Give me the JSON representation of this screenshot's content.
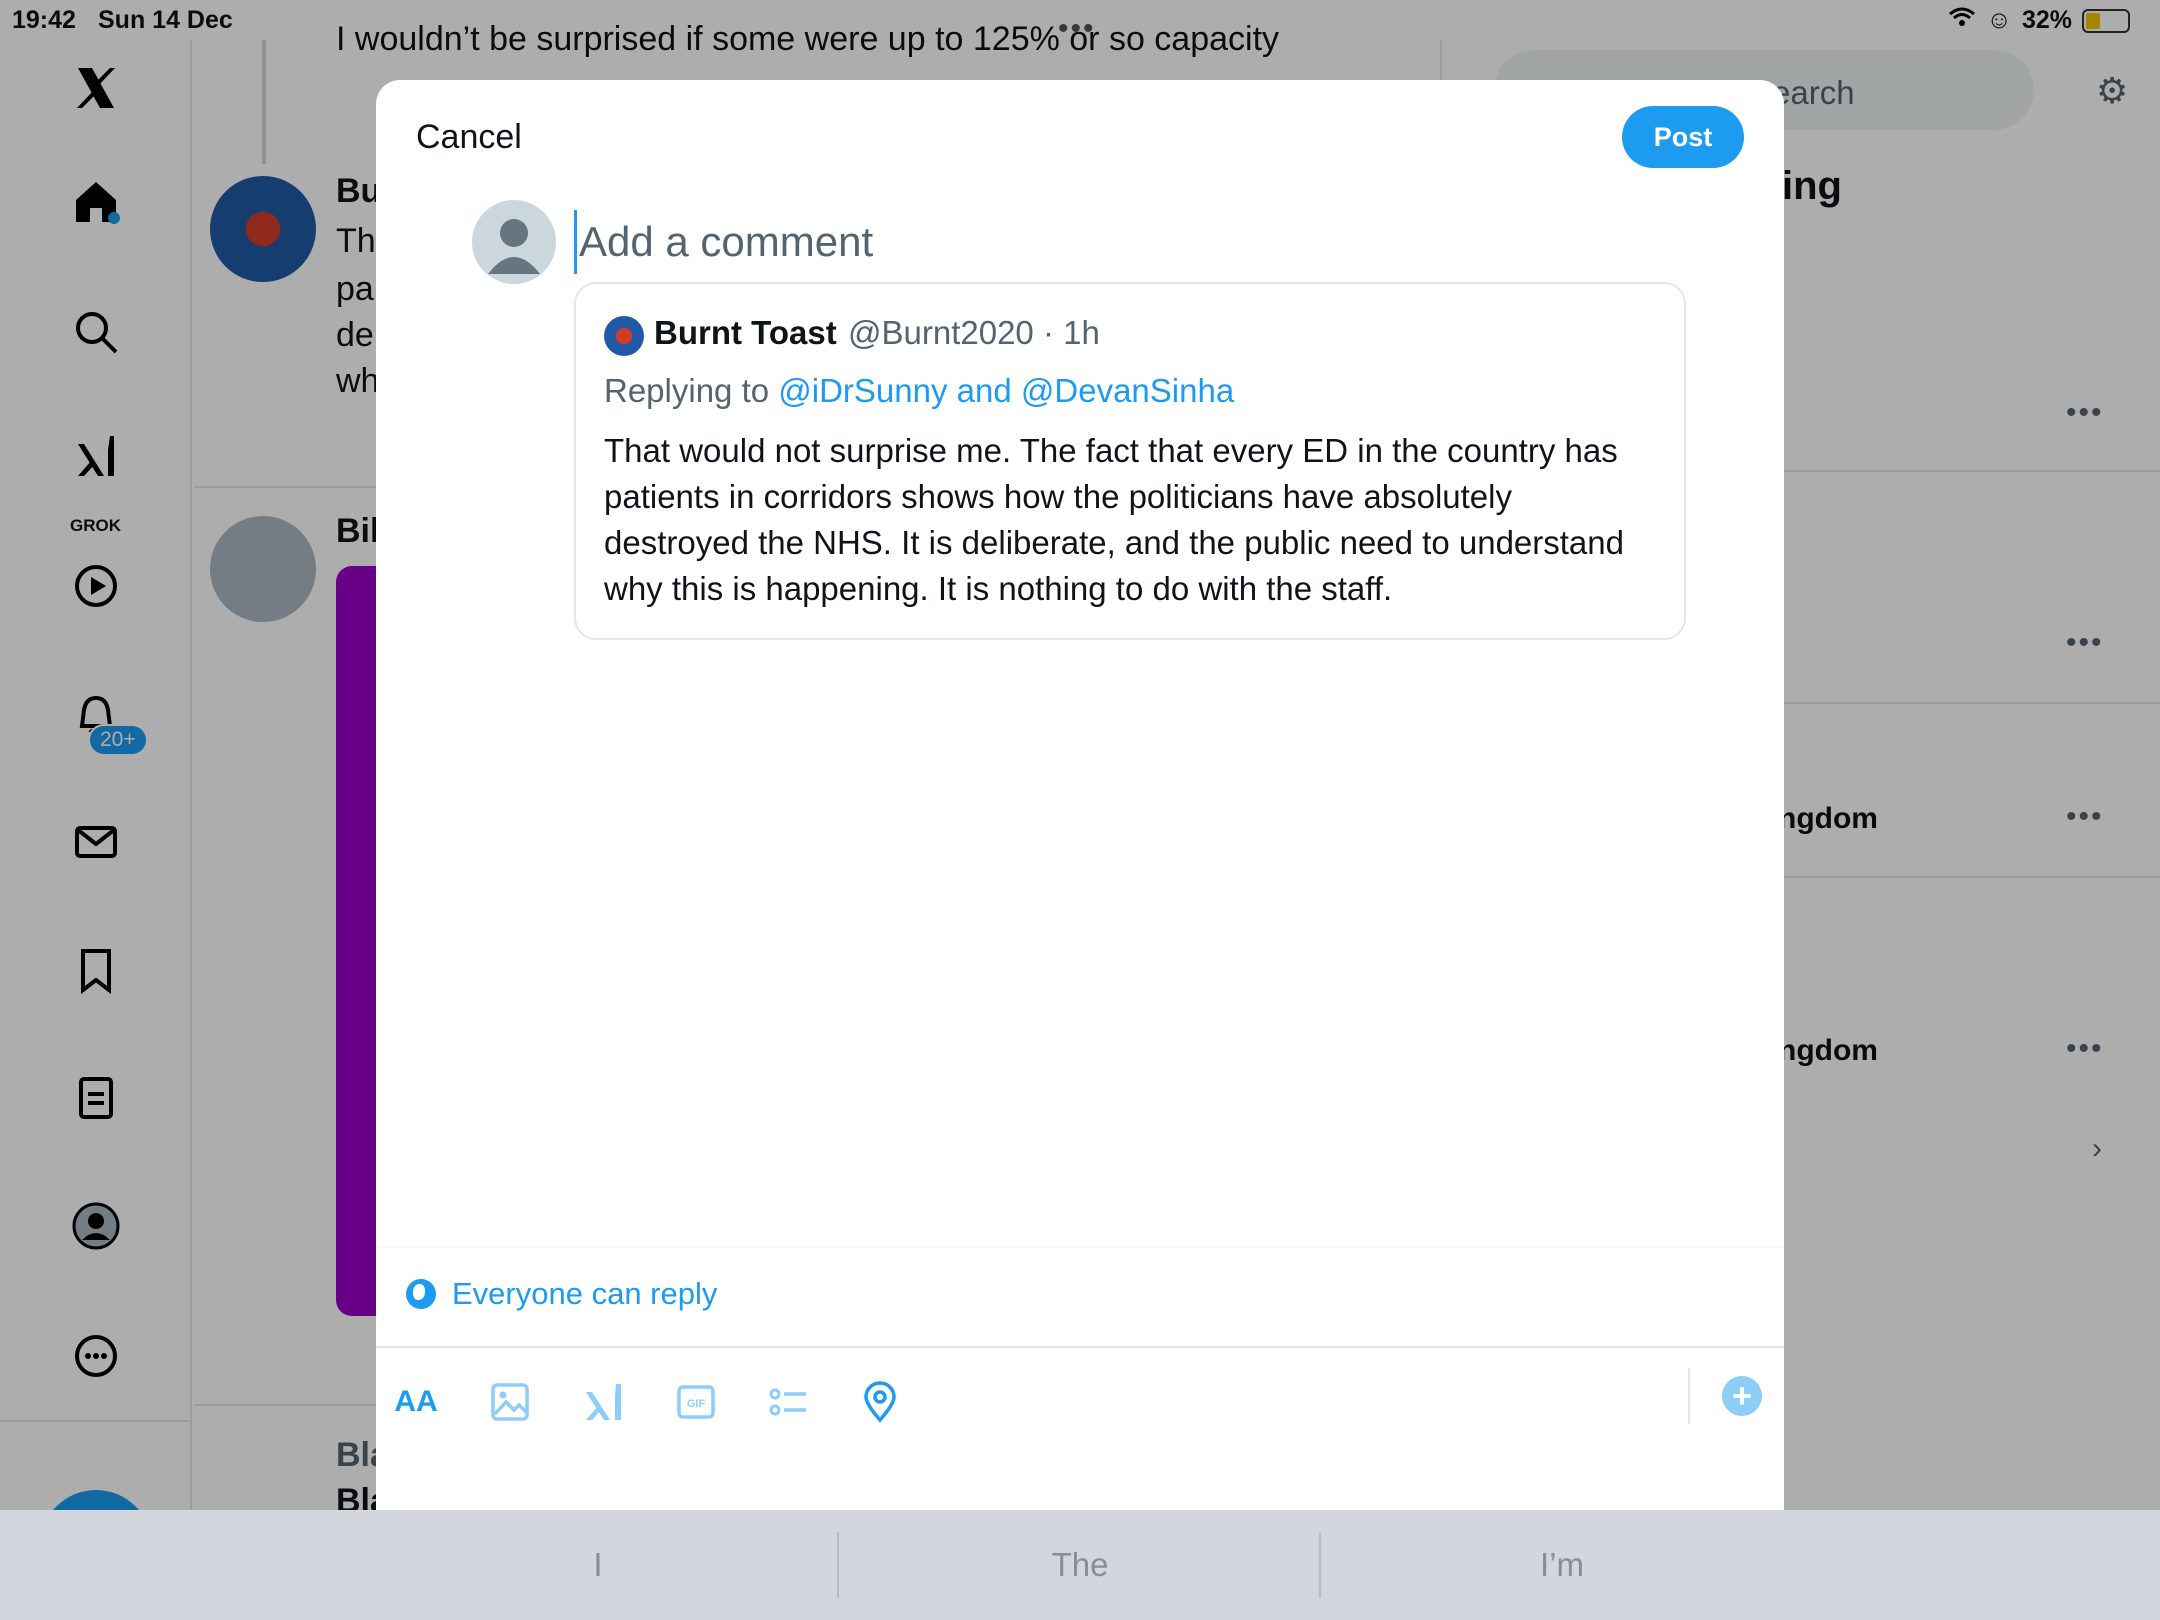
{
  "status_bar": {
    "time": "19:42",
    "date": "Sun 14 Dec",
    "battery": "32%"
  },
  "nav": {
    "grok_label": "GROK",
    "notifications_badge": "20+"
  },
  "background_timeline": {
    "top_reply_text": "I wouldn’t be surprised if some were up to 125% or so capacity",
    "post1_name_fragment": "Bu",
    "post1_lines": [
      "Th",
      "pa",
      "de",
      "wh"
    ],
    "post2_name_fragment": "Bil",
    "repost_fragment": "Bla",
    "post3_name_fragment": "Bla"
  },
  "background_right": {
    "search_placeholder": "Search",
    "section_fragment": "ing",
    "trend1_fragment": "ngdom",
    "trend2_fragment": "ngdom"
  },
  "compose": {
    "cancel_label": "Cancel",
    "post_label": "Post",
    "comment_placeholder": "Add a comment",
    "reply_setting": "Everyone can reply",
    "toolbar": {
      "text_format_label": "AA"
    }
  },
  "quoted_post": {
    "name": "Burnt Toast",
    "handle_time": "@Burnt2020 · 1h",
    "replying_prefix": "Replying to ",
    "replying_to": "@iDrSunny and @DevanSinha",
    "body": "That would not surprise me. The fact that every ED in the country has patients in corridors shows how the politicians have absolutely destroyed the NHS. It is deliberate, and the public need to understand why this is happening. It is nothing to do with the staff."
  },
  "keyboard_suggestions": [
    "I",
    "The",
    "I’m"
  ],
  "colors": {
    "accent": "#1d9bf0",
    "text": "#0f1419",
    "muted": "#536471"
  }
}
